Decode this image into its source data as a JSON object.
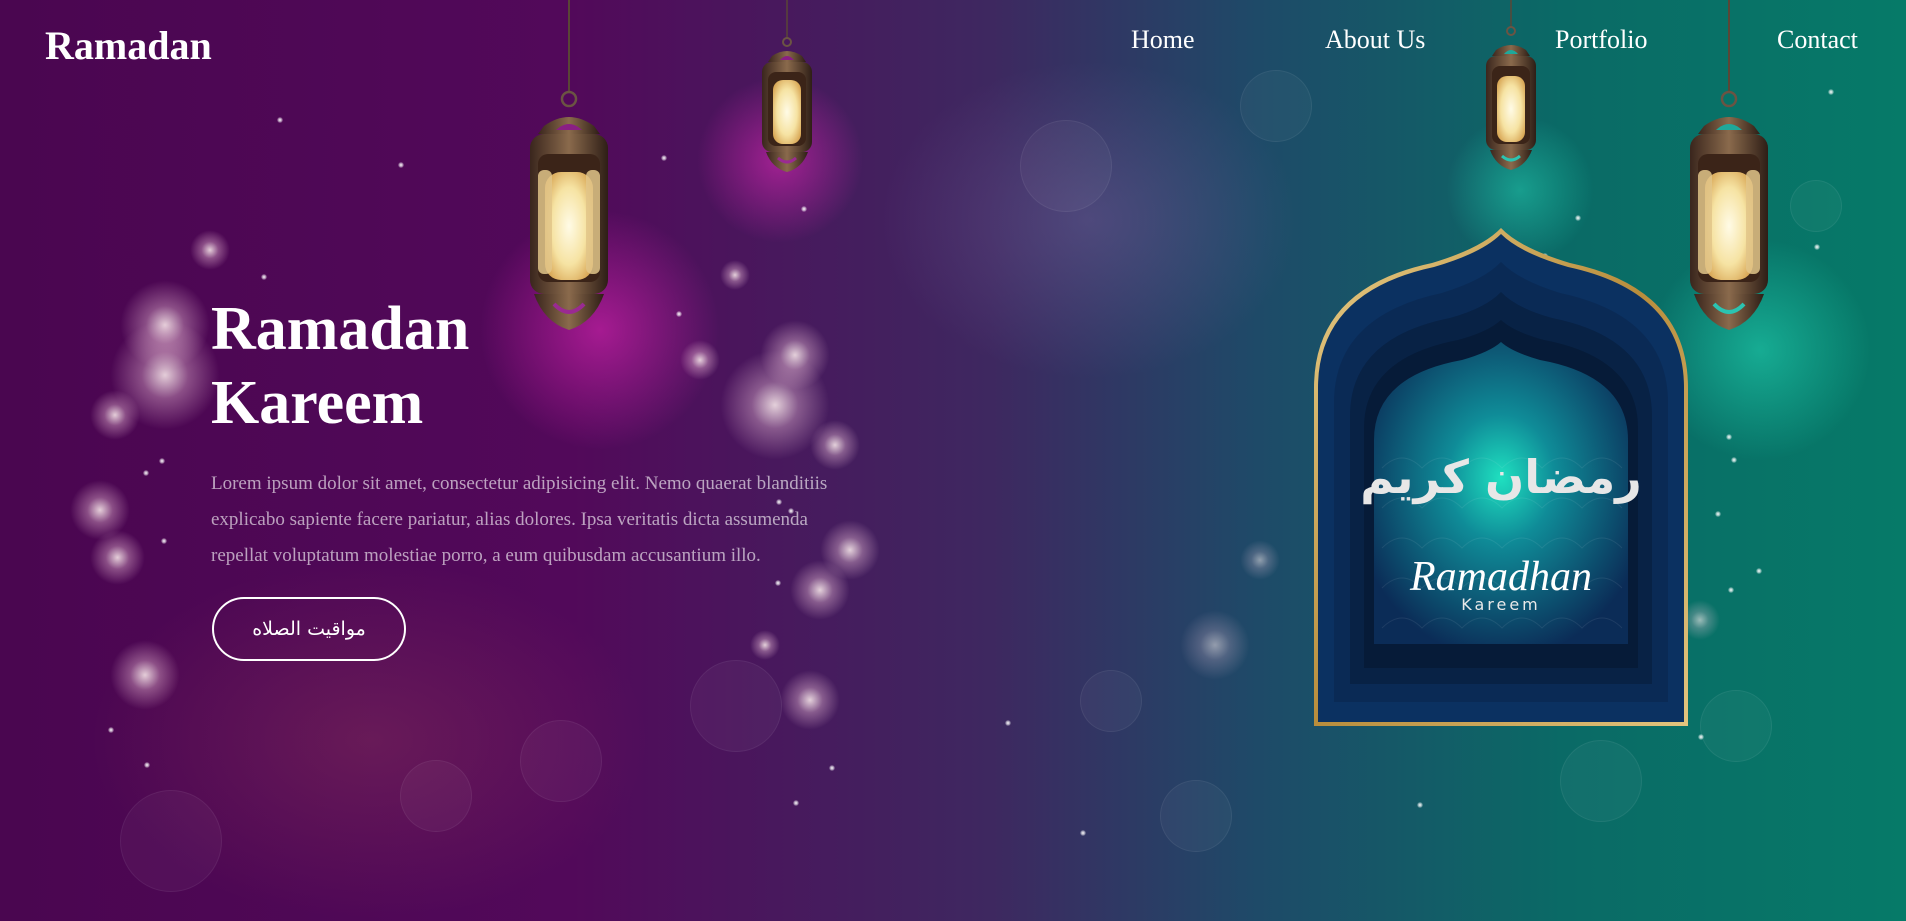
{
  "navbar": {
    "brand": "Ramadan",
    "links": [
      "Home",
      "About Us",
      "Portfolio",
      "Contact"
    ]
  },
  "hero": {
    "title_line1": "Ramadan",
    "title_line2": "Kareem",
    "description_line1": "Lorem ipsum dolor sit amet, consectetur adipisicing elit. Nemo quaerat blanditiis",
    "description_line2": "explicabo sapiente facere pariatur, alias dolores. Ipsa veritatis dicta assumenda",
    "description_line3": "repellat voluptatum molestiae porro, a eum quibusdam accusantium illo.",
    "button_label": "مواقيت الصلاه"
  },
  "card": {
    "calligraphy": "رمضان كريم",
    "script_title": "Ramadhan",
    "subtitle": "Kareem"
  },
  "icons": [
    "lantern-icon",
    "mosque-arch-icon"
  ],
  "colors": {
    "background_left": "#4a0650",
    "background_right": "#067a68",
    "text": "#ffffff",
    "arch_frame": "#c9a45a",
    "arch_inner": "#0d3a63"
  }
}
